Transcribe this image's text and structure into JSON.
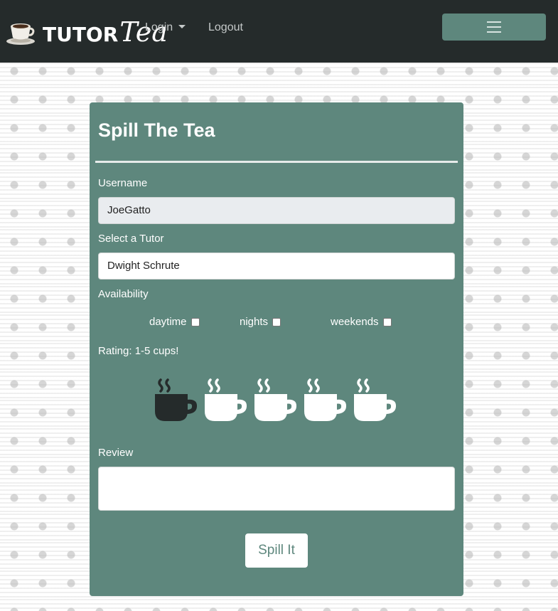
{
  "brand": {
    "name_part1": "TUTOR",
    "name_part2": "Tea",
    "icon": "coffee-cup-logo"
  },
  "nav": {
    "login_label": "Login",
    "logout_label": "Logout",
    "menu_icon": "hamburger-icon"
  },
  "form": {
    "title": "Spill The Tea",
    "username": {
      "label": "Username",
      "value": "JoeGatto"
    },
    "tutor": {
      "label": "Select a Tutor",
      "value": "Dwight Schrute"
    },
    "availability": {
      "label": "Availability",
      "options": [
        {
          "label": "daytime",
          "checked": false
        },
        {
          "label": "nights",
          "checked": false
        },
        {
          "label": "weekends",
          "checked": false
        }
      ]
    },
    "rating": {
      "label": "Rating: 1-5 cups!",
      "max": 5,
      "value": 1,
      "icon": "teacup-icon"
    },
    "review": {
      "label": "Review",
      "value": ""
    },
    "submit_label": "Spill It"
  },
  "colors": {
    "navbar": "#252b2b",
    "accent": "#5e877d",
    "cup_selected": "#252b2b",
    "cup_unselected": "#ffffff"
  }
}
